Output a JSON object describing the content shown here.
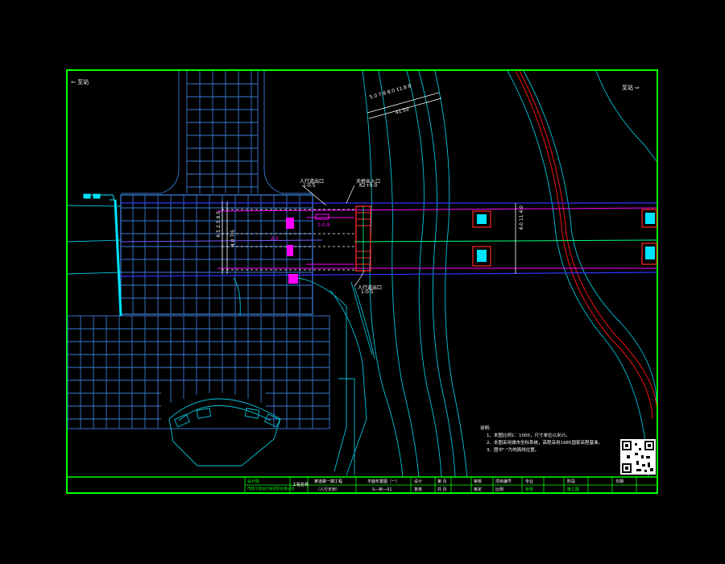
{
  "drawing": {
    "colors": {
      "background": "#000000",
      "frame": "#00ff00",
      "grid": "#3a7bd5",
      "road": "#00e5ff",
      "centerline": "#ff00ff",
      "axis": "#3333ff",
      "pier": "#ff2a2a",
      "pier_fill": "#00e5ff",
      "rail": "#e01010",
      "text": "#ffffff"
    },
    "direction_left": "⇦ 至站",
    "direction_right": "至站 ⇨",
    "callouts": {
      "left_top": "人行道出口",
      "left_top_sub": "1-0.5",
      "mid_top": "天桥出入口",
      "mid_top_sub": "K2+0.0",
      "bottom": "人行道出口",
      "bottom_sub": "1-0.5",
      "dim_top": "5.0  7.8  8.0  11.8  8",
      "dim_top_sub": "41.50",
      "magenta_a": "1-0.8",
      "magenta_b": "2.0",
      "vert_left": "6.5  2.5  8.5",
      "vert_mid": "4.0  7.5",
      "vert_right": "4.0  11  4.0"
    },
    "notes": {
      "title": "说明:",
      "line1": "1、本图比例1：1000，尺寸单位以米计。",
      "line2": "2、本图采用城市坐标系统，高程采用1985国家高程基准。",
      "line3": "3、图中\"·\"为地面线位置。"
    },
    "title_block": {
      "company_logo": "设计院",
      "company": "市政工程设计研究院有限公司",
      "project_label": "工程名称",
      "project": "某道路一期工程",
      "project_sub": "（人行天桥）",
      "drawing_name": "平面布置图（一）",
      "drawing_no": "S—桥—01",
      "design": "设计",
      "check": "复核",
      "review": "审核",
      "approve": "审定",
      "date_label": "日期",
      "sheet_label": "第 页",
      "total_label": "共 页",
      "scale_label": "比例",
      "project_no_label": "项目编号",
      "specialty_label": "专业",
      "specialty": "桥梁",
      "stage_label": "阶段",
      "stage": "施工图"
    }
  }
}
